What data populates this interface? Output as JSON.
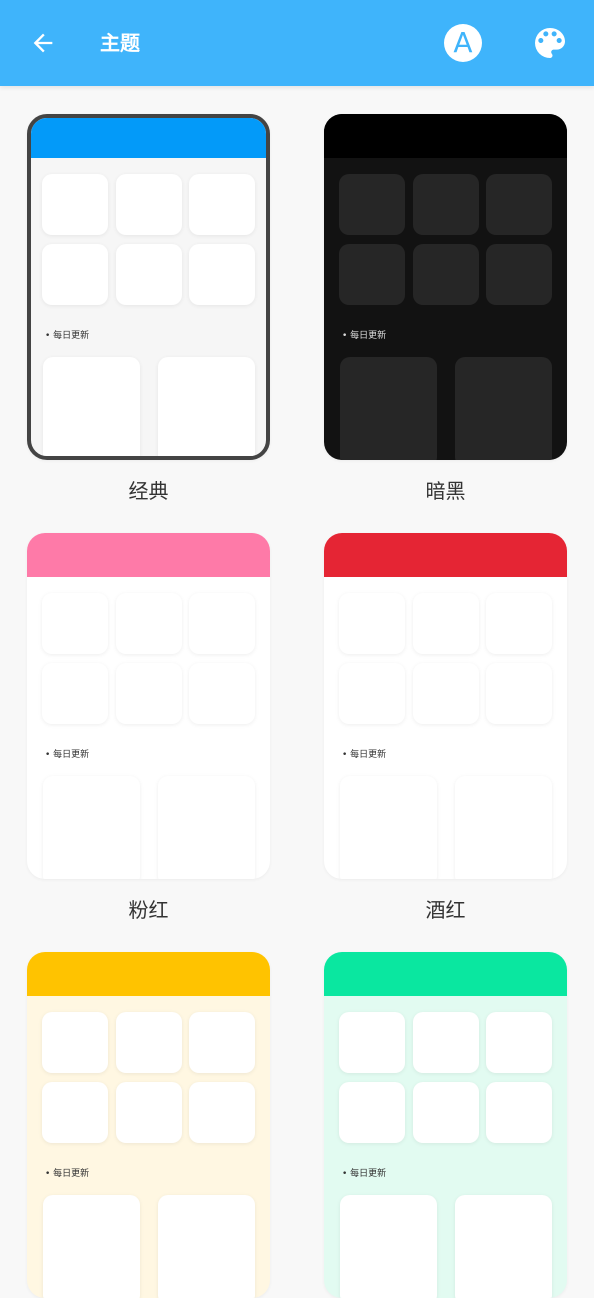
{
  "app_bar": {
    "title": "主题",
    "back_icon": "arrow-left-icon",
    "font_icon_letter": "A",
    "palette_icon": "palette-icon",
    "background": "#3fb4fb"
  },
  "themes": [
    {
      "label": "经典",
      "header_color": "#039af9",
      "body_color": "#f6f6f6",
      "daily_text": "• 每日更新",
      "selected": true
    },
    {
      "label": "暗黑",
      "header_color": "#000000",
      "body_color": "#121212",
      "daily_text": "• 每日更新",
      "selected": false
    },
    {
      "label": "粉红",
      "header_color": "#fe7aa8",
      "body_color": "#ffffff",
      "daily_text": "• 每日更新",
      "selected": false
    },
    {
      "label": "酒红",
      "header_color": "#e52534",
      "body_color": "#ffffff",
      "daily_text": "• 每日更新",
      "selected": false
    },
    {
      "label": "",
      "header_color": "#ffc300",
      "body_color": "#fff7e2",
      "daily_text": "• 每日更新",
      "selected": false
    },
    {
      "label": "",
      "header_color": "#0ae7a0",
      "body_color": "#e2fbf1",
      "daily_text": "• 每日更新",
      "selected": false
    }
  ]
}
